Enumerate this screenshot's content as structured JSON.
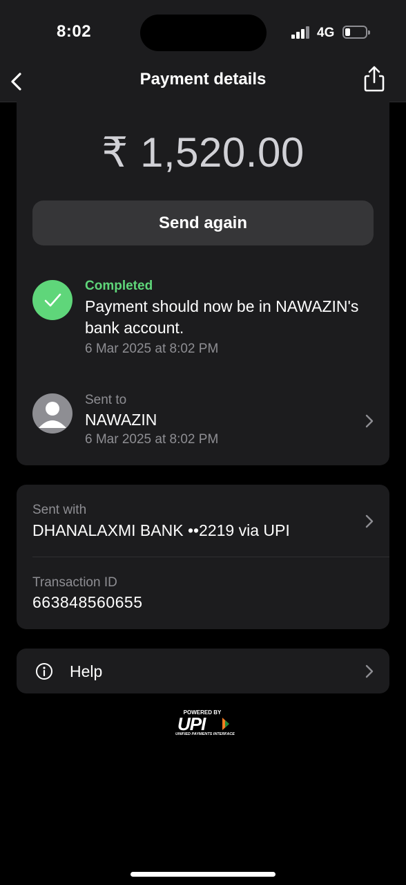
{
  "status_bar": {
    "time": "8:02",
    "network": "4G",
    "battery_level_fraction": 0.2
  },
  "nav": {
    "title": "Payment details",
    "back_icon": "chevron-left-icon",
    "share_icon": "share-icon"
  },
  "payment": {
    "amount": "₹ 1,520.00",
    "send_again_label": "Send again",
    "status": {
      "label": "Completed",
      "message": "Payment should now be in NAWAZIN's bank account.",
      "date": "6 Mar 2025 at 8:02 PM",
      "icon": "check-circle-icon"
    },
    "recipient": {
      "label": "Sent to",
      "name": "NAWAZIN",
      "date": "6 Mar 2025 at 8:02 PM",
      "icon": "avatar-icon"
    }
  },
  "details": {
    "sent_with_label": "Sent with",
    "sent_with_value": "DHANALAXMI BANK ••2219 via UPI",
    "transaction_id_label": "Transaction ID",
    "transaction_id": "663848560655"
  },
  "help": {
    "label": "Help",
    "icon": "info-icon"
  },
  "footer": {
    "powered_by": "POWERED BY",
    "brand": "UPI",
    "brand_sub": "UNIFIED PAYMENTS INTERFACE"
  },
  "colors": {
    "background": "#000000",
    "card": "#1c1c1e",
    "success": "#5fd67a",
    "muted": "#8e8e93"
  }
}
